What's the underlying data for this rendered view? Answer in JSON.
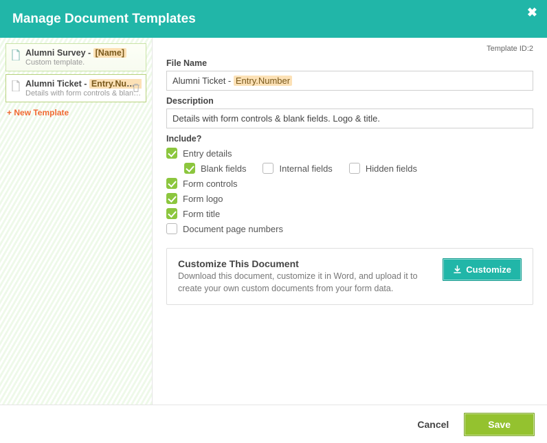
{
  "header": {
    "title": "Manage Document Templates",
    "close_label": "✖"
  },
  "sidebar": {
    "items": [
      {
        "title_prefix": "Alumni Survey - ",
        "title_tag": "[Name]",
        "subtitle": "Custom template."
      },
      {
        "title_prefix": "Alumni Ticket - ",
        "title_tag": "Entry.Numb...",
        "subtitle": "Details with form controls & blank fie..."
      }
    ],
    "new_template_label": "New Template"
  },
  "main": {
    "template_id_label": "Template ID:",
    "template_id_value": "2",
    "file_name_label": "File Name",
    "file_name_prefix": "Alumni Ticket - ",
    "file_name_tag": "Entry.Number",
    "description_label": "Description",
    "description_value": "Details with form controls & blank fields. Logo & title.",
    "include_label": "Include?",
    "checks": {
      "entry_details": "Entry details",
      "blank_fields": "Blank fields",
      "internal_fields": "Internal fields",
      "hidden_fields": "Hidden fields",
      "form_controls": "Form controls",
      "form_logo": "Form logo",
      "form_title": "Form title",
      "doc_page_numbers": "Document page numbers"
    },
    "customize": {
      "title": "Customize This Document",
      "desc": "Download this document, customize it in Word, and upload it to create your own custom documents from your form data.",
      "button": "Customize"
    }
  },
  "footer": {
    "cancel": "Cancel",
    "save": "Save"
  }
}
